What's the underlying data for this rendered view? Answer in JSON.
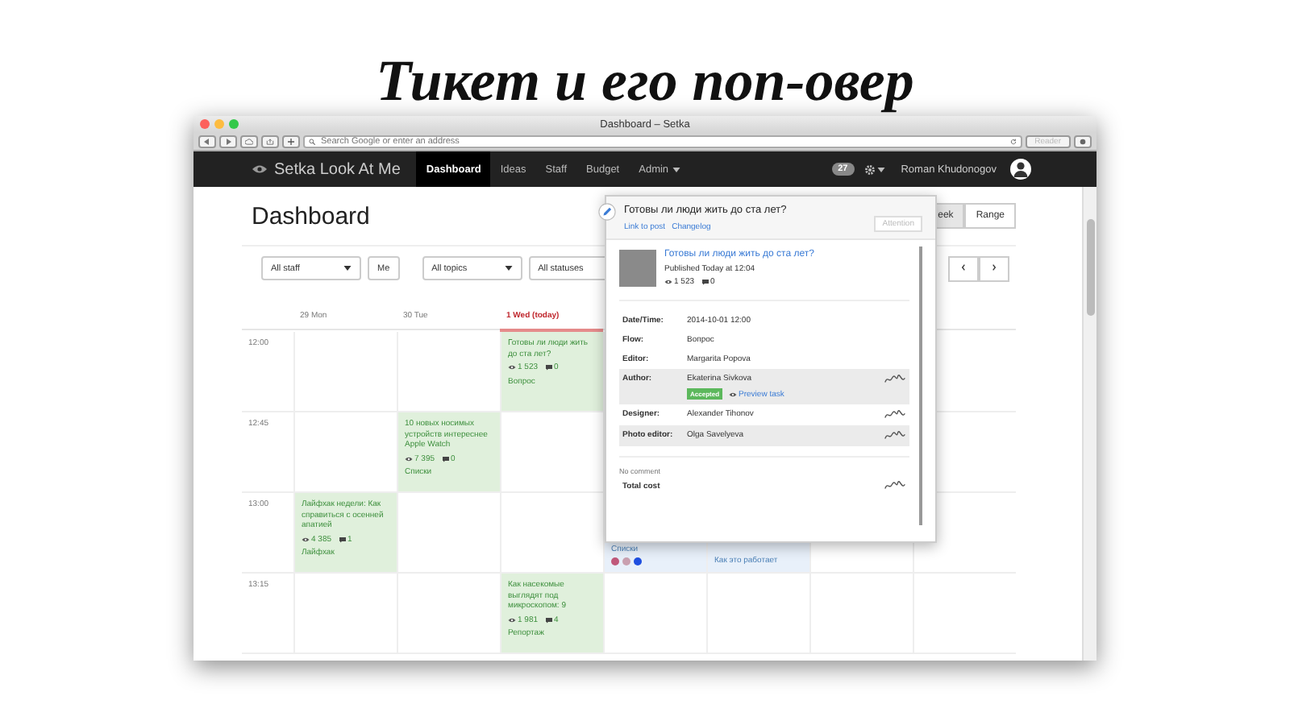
{
  "slide_title": "Тикет и его поп-овер",
  "window": {
    "title": "Dashboard – Setka",
    "address_placeholder": "Search Google or enter an address",
    "reader_button": "Reader"
  },
  "navbar": {
    "brand": "Setka Look At Me",
    "items": [
      {
        "label": "Dashboard",
        "selected": true,
        "dropdown": false
      },
      {
        "label": "Ideas",
        "selected": false,
        "dropdown": false
      },
      {
        "label": "Staff",
        "selected": false,
        "dropdown": false
      },
      {
        "label": "Budget",
        "selected": false,
        "dropdown": false
      },
      {
        "label": "Admin",
        "selected": false,
        "dropdown": true
      }
    ],
    "badge": "27",
    "user": "Roman Khudonogov"
  },
  "page": {
    "title": "Dashboard",
    "view_buttons": [
      {
        "label": "eek",
        "selected": true
      },
      {
        "label": "Range",
        "selected": false
      }
    ],
    "filters": [
      {
        "label": "All staff",
        "kind": "select"
      },
      {
        "label": "Me",
        "kind": "button"
      },
      {
        "label": "All topics",
        "kind": "select"
      },
      {
        "label": "All statuses",
        "kind": "select"
      }
    ]
  },
  "calendar": {
    "days": [
      {
        "label": "29 Mon",
        "today": false
      },
      {
        "label": "30 Tue",
        "today": false
      },
      {
        "label": "1 Wed (today)",
        "today": true
      }
    ],
    "rows": [
      {
        "time": "12:00",
        "cells": [
          {
            "kind": "empty"
          },
          {
            "kind": "empty"
          },
          {
            "kind": "full",
            "title": "Готовы ли люди жить до ста лет?",
            "views": "1 523",
            "comments": "0",
            "flow": "Вопрос"
          },
          {
            "kind": "empty"
          },
          {
            "kind": "empty"
          },
          {
            "kind": "empty"
          },
          {
            "kind": "empty"
          }
        ]
      },
      {
        "time": "12:45",
        "cells": [
          {
            "kind": "empty"
          },
          {
            "kind": "full",
            "title": "10 новых носимых устройств интереснее Apple Watch",
            "views": "7 395",
            "comments": "0",
            "flow": "Списки"
          },
          {
            "kind": "empty"
          },
          {
            "kind": "empty"
          },
          {
            "kind": "empty"
          },
          {
            "kind": "empty"
          },
          {
            "kind": "empty"
          }
        ]
      },
      {
        "time": "13:00",
        "cells": [
          {
            "kind": "full",
            "title": "Лайфхак недели: Как справиться с осенней апатией",
            "views": "4 385",
            "comments": "1",
            "flow": "Лайфхак"
          },
          {
            "kind": "empty"
          },
          {
            "kind": "empty"
          },
          {
            "kind": "partial",
            "flow": "Списки",
            "dots": [
              {
                "color": "#c0587a"
              },
              {
                "color": "#c9a0b0"
              },
              {
                "color": "#1f4fe0"
              }
            ]
          },
          {
            "kind": "partial",
            "flow": "Как это работает"
          },
          {
            "kind": "empty"
          },
          {
            "kind": "empty"
          }
        ]
      },
      {
        "time": "13:15",
        "cells": [
          {
            "kind": "empty"
          },
          {
            "kind": "empty"
          },
          {
            "kind": "full",
            "title": "Как насекомые выглядят под микроскопом: 9",
            "views": "1 981",
            "comments": "4",
            "flow": "Репортаж"
          },
          {
            "kind": "empty"
          },
          {
            "kind": "empty"
          },
          {
            "kind": "empty"
          },
          {
            "kind": "empty"
          }
        ]
      }
    ]
  },
  "popover": {
    "title": "Готовы ли люди жить до ста лет?",
    "links": [
      "Link to post",
      "Changelog"
    ],
    "attention_button": {
      "label": "Attention",
      "disabled": true
    },
    "post": {
      "title": "Готовы ли люди жить до ста лет?",
      "published": "Published Today at 12:04",
      "views": "1 523",
      "comments": "0"
    },
    "fields": [
      {
        "label": "Date/Time:",
        "value": "2014-10-01  12:00",
        "shaded": false,
        "signed": false
      },
      {
        "label": "Flow:",
        "value": "Вопрос",
        "shaded": false,
        "signed": false
      },
      {
        "label": "Editor:",
        "value": "Margarita Popova",
        "shaded": false,
        "signed": false
      },
      {
        "label": "Author:",
        "value": "Ekaterina Sivkova",
        "shaded": true,
        "signed": true,
        "badge": "Accepted",
        "link": "Preview task"
      },
      {
        "label": "Designer:",
        "value": "Alexander Tihonov",
        "shaded": false,
        "signed": true
      },
      {
        "label": "Photo editor:",
        "value": "Olga Savelyeva",
        "shaded": true,
        "signed": true
      }
    ],
    "comment": "No comment",
    "total_label": "Total cost",
    "total_signed": true
  }
}
